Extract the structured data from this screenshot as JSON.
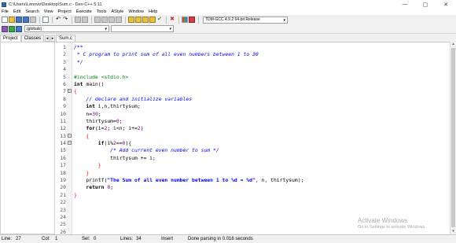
{
  "window": {
    "title": "C:\\Users\\Lenovo\\Desktop\\Sum.c - Dev-C++ 5.11",
    "controls": [
      "—",
      "▢",
      "✕"
    ]
  },
  "menu": [
    "File",
    "Edit",
    "Search",
    "View",
    "Project",
    "Execute",
    "Tools",
    "AStyle",
    "Window",
    "Help"
  ],
  "toolbar": {
    "compiler": "TDM-GCC 4.9.2 64-bit Release",
    "globals": "(globals)"
  },
  "left_panel": {
    "tabs": [
      "Project",
      "Classes"
    ],
    "arrows": "◂ ▸"
  },
  "editor": {
    "file_tab": "Sum.c",
    "lines": [
      {
        "n": "1",
        "fold": "",
        "code": [
          {
            "t": "/**",
            "c": "c-comment"
          }
        ]
      },
      {
        "n": "2",
        "fold": "",
        "code": [
          {
            "t": " * C program to print sum of all even numbers between 1 to 30",
            "c": "c-comment"
          }
        ]
      },
      {
        "n": "3",
        "fold": "",
        "code": [
          {
            "t": " */",
            "c": "c-comment"
          }
        ]
      },
      {
        "n": "4",
        "fold": "",
        "code": []
      },
      {
        "n": "5",
        "fold": "",
        "code": [
          {
            "t": "#include <stdio.h>",
            "c": "c-pre"
          }
        ]
      },
      {
        "n": "6",
        "fold": "",
        "code": [
          {
            "t": "int",
            "c": "c-kw"
          },
          {
            "t": " main()",
            "c": "c-id"
          }
        ]
      },
      {
        "n": "7",
        "fold": "−",
        "code": [
          {
            "t": "{",
            "c": "c-sym"
          }
        ]
      },
      {
        "n": "8",
        "fold": "",
        "code": [
          {
            "t": "    // declare and initialize variables",
            "c": "c-comment"
          }
        ]
      },
      {
        "n": "9",
        "fold": "",
        "code": [
          {
            "t": "    ",
            "c": "c-id"
          },
          {
            "t": "int",
            "c": "c-kw"
          },
          {
            "t": " i,n,thirtysum;",
            "c": "c-id"
          }
        ]
      },
      {
        "n": "10",
        "fold": "",
        "code": [
          {
            "t": "    n=",
            "c": "c-id"
          },
          {
            "t": "30",
            "c": "c-num"
          },
          {
            "t": ";",
            "c": "c-id"
          }
        ]
      },
      {
        "n": "11",
        "fold": "",
        "code": [
          {
            "t": "    thirtysum=",
            "c": "c-id"
          },
          {
            "t": "0",
            "c": "c-num"
          },
          {
            "t": ";",
            "c": "c-id"
          }
        ]
      },
      {
        "n": "12",
        "fold": "",
        "code": [
          {
            "t": "    ",
            "c": "c-id"
          },
          {
            "t": "for",
            "c": "c-kw"
          },
          {
            "t": "(i=",
            "c": "c-id"
          },
          {
            "t": "2",
            "c": "c-num"
          },
          {
            "t": "; i<n; i+=",
            "c": "c-id"
          },
          {
            "t": "2",
            "c": "c-num"
          },
          {
            "t": ")",
            "c": "c-id"
          }
        ]
      },
      {
        "n": "13",
        "fold": "−",
        "code": [
          {
            "t": "    {",
            "c": "c-sym"
          }
        ]
      },
      {
        "n": "14",
        "fold": "−",
        "code": [
          {
            "t": "        ",
            "c": "c-id"
          },
          {
            "t": "if",
            "c": "c-kw"
          },
          {
            "t": "(i%",
            "c": "c-id"
          },
          {
            "t": "2",
            "c": "c-num"
          },
          {
            "t": "==",
            "c": "c-id"
          },
          {
            "t": "0",
            "c": "c-num"
          },
          {
            "t": "){",
            "c": "c-id"
          }
        ]
      },
      {
        "n": "15",
        "fold": "",
        "code": [
          {
            "t": "            /* Add current even number to sum */",
            "c": "c-comment"
          }
        ]
      },
      {
        "n": "16",
        "fold": "",
        "code": [
          {
            "t": "            thirtysum += i;",
            "c": "c-id"
          }
        ]
      },
      {
        "n": "17",
        "fold": "",
        "code": [
          {
            "t": "        }",
            "c": "c-sym"
          }
        ]
      },
      {
        "n": "18",
        "fold": "",
        "code": [
          {
            "t": "    }",
            "c": "c-sym"
          }
        ]
      },
      {
        "n": "19",
        "fold": "",
        "code": [
          {
            "t": "    printf(",
            "c": "c-id"
          },
          {
            "t": "\"The Sum of all even number between 1 to %d = %d\"",
            "c": "c-str"
          },
          {
            "t": ", n, thirtysum);",
            "c": "c-id"
          }
        ]
      },
      {
        "n": "20",
        "fold": "",
        "code": [
          {
            "t": "    ",
            "c": "c-id"
          },
          {
            "t": "return",
            "c": "c-kw"
          },
          {
            "t": " ",
            "c": "c-id"
          },
          {
            "t": "0",
            "c": "c-num"
          },
          {
            "t": ";",
            "c": "c-id"
          }
        ]
      },
      {
        "n": "21",
        "fold": "",
        "code": [
          {
            "t": "}",
            "c": "c-sym"
          }
        ]
      },
      {
        "n": "22",
        "fold": "",
        "code": []
      },
      {
        "n": "23",
        "fold": "",
        "code": []
      },
      {
        "n": "24",
        "fold": "",
        "code": []
      },
      {
        "n": "25",
        "fold": "",
        "code": []
      },
      {
        "n": "26",
        "fold": "",
        "code": []
      }
    ]
  },
  "watermark": {
    "title": "Activate Windows",
    "subtitle": "Go to Settings to activate Windows."
  },
  "status": {
    "line_label": "Line:",
    "line_value": "27",
    "col_label": "Col:",
    "col_value": "1",
    "sel_label": "Sel:",
    "sel_value": "0",
    "lines_label": "Lines:",
    "lines_value": "34",
    "mode": "Insert",
    "message": "Done parsing in 0.016 seconds"
  },
  "icons": {
    "scroll_up": "▴",
    "scroll_down": "▾",
    "combo_arrow": "▾",
    "check": "✔",
    "cross": "✖"
  }
}
